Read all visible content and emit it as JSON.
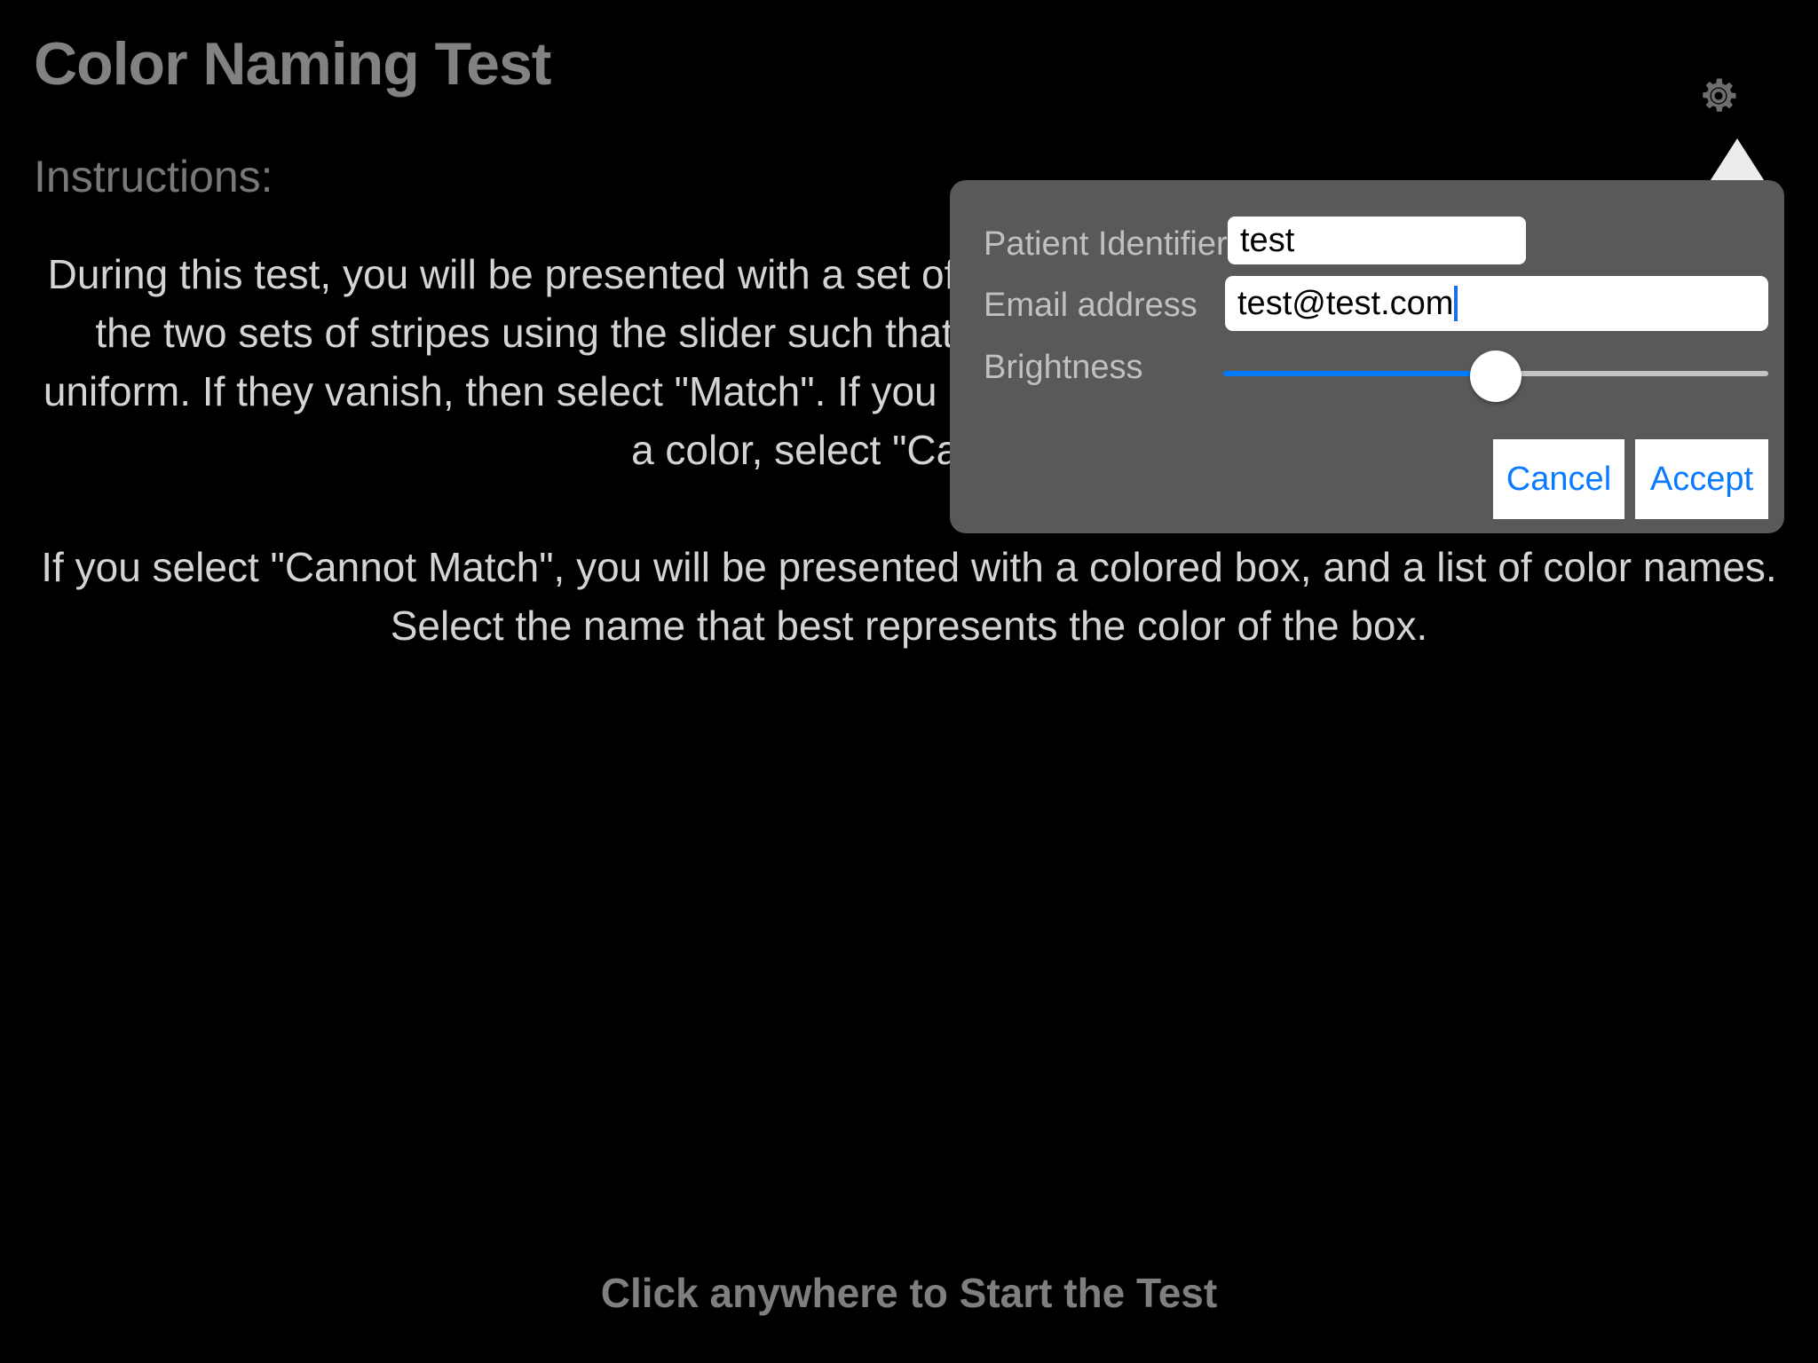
{
  "app": {
    "title": "Color Naming Test",
    "background_color": "#000000",
    "title_color": "#828282"
  },
  "header": {
    "gear_icon": "gear-icon"
  },
  "instructions": {
    "heading": "Instructions:",
    "paragraphs": [
      "During this test, you will be presented with a set of colored stripes. You should attempt to match the two sets of stripes using the slider such that the stripes vanish and the screen appears uniform. If they vanish, then select \"Match\". If you cannot make them vanish, and the stripes are a color, select \"Cannot Match\".",
      "If you select \"Cannot Match\", you will be presented with a colored box, and a list of color names. Select the name that best represents the color of the box."
    ],
    "text_color": "#d4d4d4"
  },
  "footer": {
    "start_hint": "Click anywhere to Start the Test",
    "color": "#7f7f7f"
  },
  "settings_popover": {
    "background_color": "#595959",
    "arrow_color": "#ececec",
    "fields": {
      "patient_identifier": {
        "label": "Patient Identifier",
        "value": "test",
        "placeholder": ""
      },
      "email_address": {
        "label": "Email address",
        "value": "test@test.com",
        "placeholder": "",
        "focused": true,
        "caret_color": "#1a6fe8"
      },
      "brightness": {
        "label": "Brightness",
        "value": 50,
        "min": 0,
        "max": 100,
        "fill_color": "#007aff",
        "track_color": "#c3c3c3",
        "thumb_color": "#ffffff"
      }
    },
    "buttons": {
      "cancel": "Cancel",
      "accept": "Accept",
      "text_color": "#0a7bff",
      "background_color": "#ffffff"
    }
  }
}
